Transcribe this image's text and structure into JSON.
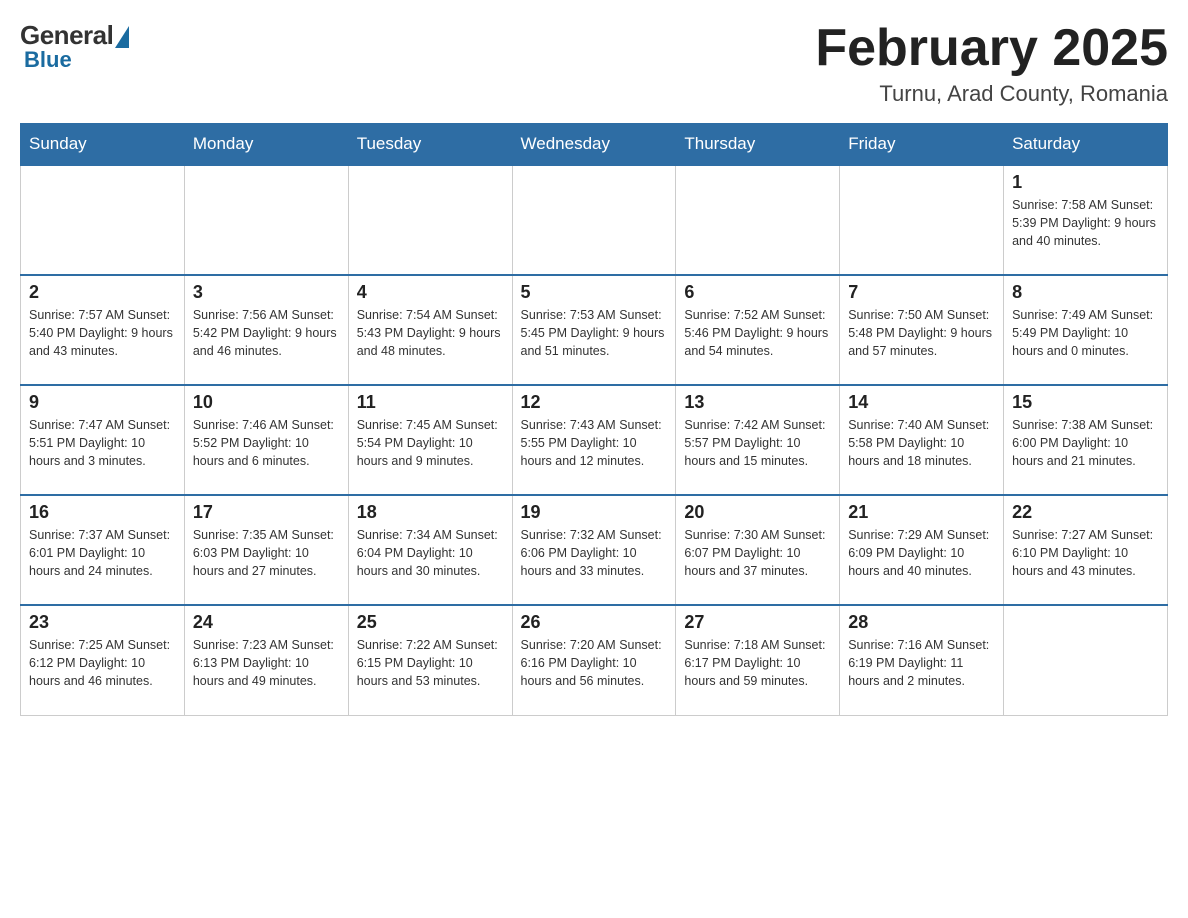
{
  "header": {
    "logo": {
      "general": "General",
      "blue": "Blue"
    },
    "title": "February 2025",
    "location": "Turnu, Arad County, Romania"
  },
  "days_of_week": [
    "Sunday",
    "Monday",
    "Tuesday",
    "Wednesday",
    "Thursday",
    "Friday",
    "Saturday"
  ],
  "weeks": [
    [
      {
        "day": "",
        "info": ""
      },
      {
        "day": "",
        "info": ""
      },
      {
        "day": "",
        "info": ""
      },
      {
        "day": "",
        "info": ""
      },
      {
        "day": "",
        "info": ""
      },
      {
        "day": "",
        "info": ""
      },
      {
        "day": "1",
        "info": "Sunrise: 7:58 AM\nSunset: 5:39 PM\nDaylight: 9 hours and 40 minutes."
      }
    ],
    [
      {
        "day": "2",
        "info": "Sunrise: 7:57 AM\nSunset: 5:40 PM\nDaylight: 9 hours and 43 minutes."
      },
      {
        "day": "3",
        "info": "Sunrise: 7:56 AM\nSunset: 5:42 PM\nDaylight: 9 hours and 46 minutes."
      },
      {
        "day": "4",
        "info": "Sunrise: 7:54 AM\nSunset: 5:43 PM\nDaylight: 9 hours and 48 minutes."
      },
      {
        "day": "5",
        "info": "Sunrise: 7:53 AM\nSunset: 5:45 PM\nDaylight: 9 hours and 51 minutes."
      },
      {
        "day": "6",
        "info": "Sunrise: 7:52 AM\nSunset: 5:46 PM\nDaylight: 9 hours and 54 minutes."
      },
      {
        "day": "7",
        "info": "Sunrise: 7:50 AM\nSunset: 5:48 PM\nDaylight: 9 hours and 57 minutes."
      },
      {
        "day": "8",
        "info": "Sunrise: 7:49 AM\nSunset: 5:49 PM\nDaylight: 10 hours and 0 minutes."
      }
    ],
    [
      {
        "day": "9",
        "info": "Sunrise: 7:47 AM\nSunset: 5:51 PM\nDaylight: 10 hours and 3 minutes."
      },
      {
        "day": "10",
        "info": "Sunrise: 7:46 AM\nSunset: 5:52 PM\nDaylight: 10 hours and 6 minutes."
      },
      {
        "day": "11",
        "info": "Sunrise: 7:45 AM\nSunset: 5:54 PM\nDaylight: 10 hours and 9 minutes."
      },
      {
        "day": "12",
        "info": "Sunrise: 7:43 AM\nSunset: 5:55 PM\nDaylight: 10 hours and 12 minutes."
      },
      {
        "day": "13",
        "info": "Sunrise: 7:42 AM\nSunset: 5:57 PM\nDaylight: 10 hours and 15 minutes."
      },
      {
        "day": "14",
        "info": "Sunrise: 7:40 AM\nSunset: 5:58 PM\nDaylight: 10 hours and 18 minutes."
      },
      {
        "day": "15",
        "info": "Sunrise: 7:38 AM\nSunset: 6:00 PM\nDaylight: 10 hours and 21 minutes."
      }
    ],
    [
      {
        "day": "16",
        "info": "Sunrise: 7:37 AM\nSunset: 6:01 PM\nDaylight: 10 hours and 24 minutes."
      },
      {
        "day": "17",
        "info": "Sunrise: 7:35 AM\nSunset: 6:03 PM\nDaylight: 10 hours and 27 minutes."
      },
      {
        "day": "18",
        "info": "Sunrise: 7:34 AM\nSunset: 6:04 PM\nDaylight: 10 hours and 30 minutes."
      },
      {
        "day": "19",
        "info": "Sunrise: 7:32 AM\nSunset: 6:06 PM\nDaylight: 10 hours and 33 minutes."
      },
      {
        "day": "20",
        "info": "Sunrise: 7:30 AM\nSunset: 6:07 PM\nDaylight: 10 hours and 37 minutes."
      },
      {
        "day": "21",
        "info": "Sunrise: 7:29 AM\nSunset: 6:09 PM\nDaylight: 10 hours and 40 minutes."
      },
      {
        "day": "22",
        "info": "Sunrise: 7:27 AM\nSunset: 6:10 PM\nDaylight: 10 hours and 43 minutes."
      }
    ],
    [
      {
        "day": "23",
        "info": "Sunrise: 7:25 AM\nSunset: 6:12 PM\nDaylight: 10 hours and 46 minutes."
      },
      {
        "day": "24",
        "info": "Sunrise: 7:23 AM\nSunset: 6:13 PM\nDaylight: 10 hours and 49 minutes."
      },
      {
        "day": "25",
        "info": "Sunrise: 7:22 AM\nSunset: 6:15 PM\nDaylight: 10 hours and 53 minutes."
      },
      {
        "day": "26",
        "info": "Sunrise: 7:20 AM\nSunset: 6:16 PM\nDaylight: 10 hours and 56 minutes."
      },
      {
        "day": "27",
        "info": "Sunrise: 7:18 AM\nSunset: 6:17 PM\nDaylight: 10 hours and 59 minutes."
      },
      {
        "day": "28",
        "info": "Sunrise: 7:16 AM\nSunset: 6:19 PM\nDaylight: 11 hours and 2 minutes."
      },
      {
        "day": "",
        "info": ""
      }
    ]
  ]
}
